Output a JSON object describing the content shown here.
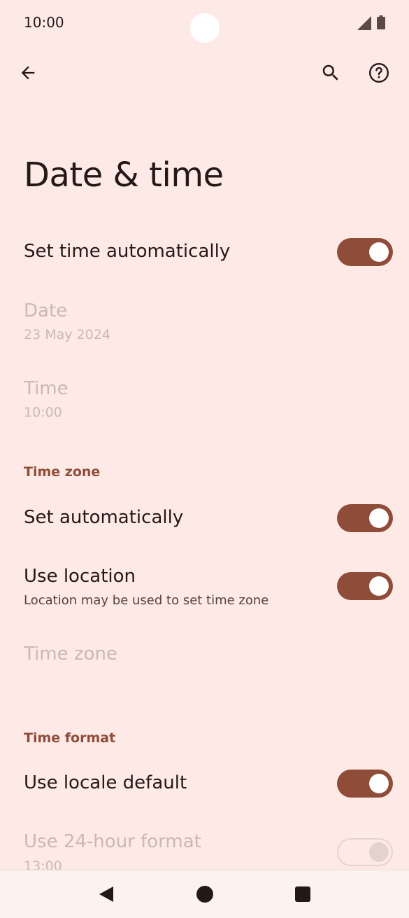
{
  "status_bar": {
    "time": "10:00",
    "icons": [
      "signal-icon",
      "battery-icon"
    ]
  },
  "toolbar": {
    "icons": [
      "back-arrow-icon",
      "search-icon",
      "help-icon"
    ]
  },
  "page": {
    "title": "Date & time"
  },
  "settings": {
    "set_time_automatically": {
      "title": "Set time automatically",
      "enabled": true
    },
    "date": {
      "title": "Date",
      "value": "23 May 2024"
    },
    "time": {
      "title": "Time",
      "value": "10:00"
    },
    "time_zone_section": {
      "header": "Time zone"
    },
    "set_automatically": {
      "title": "Set automatically",
      "enabled": true
    },
    "use_location": {
      "title": "Use location",
      "summary": "Location may be used to set time zone",
      "enabled": true
    },
    "time_zone": {
      "title": "Time zone"
    },
    "time_format_section": {
      "header": "Time format"
    },
    "use_locale_default": {
      "title": "Use locale default",
      "enabled": true
    },
    "use_24_hour": {
      "title": "Use 24-hour format",
      "value": "13:00",
      "enabled": false
    }
  },
  "colors": {
    "background": "#fdeae6",
    "accent": "#8f4c38",
    "text_primary": "#231917",
    "text_disabled": "#c9b8b4"
  },
  "nav_bar": {
    "icons": [
      "nav-back-icon",
      "nav-home-icon",
      "nav-recents-icon"
    ]
  }
}
